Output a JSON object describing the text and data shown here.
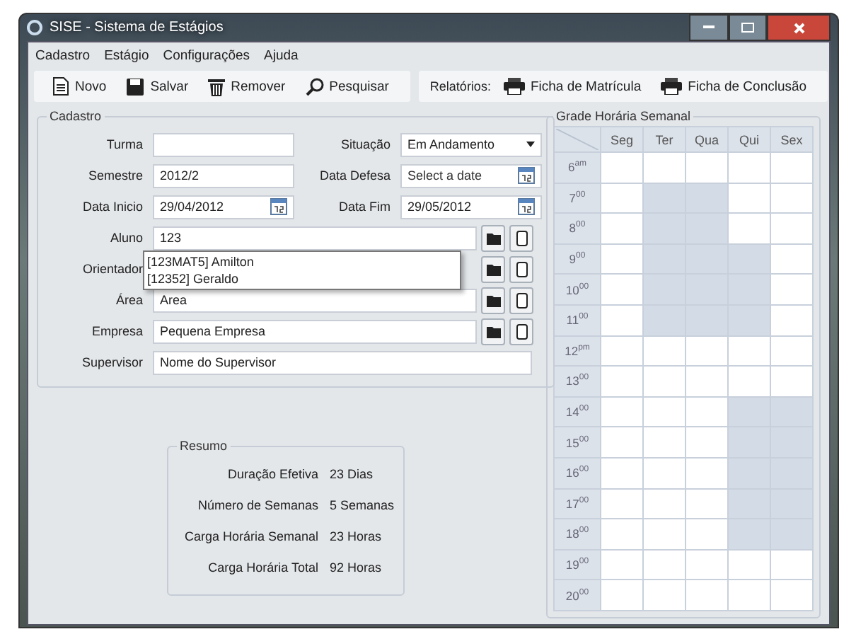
{
  "window": {
    "title": "SISE - Sistema de Estágios"
  },
  "menu": [
    "Cadastro",
    "Estágio",
    "Configurações",
    "Ajuda"
  ],
  "toolbar": [
    {
      "kind": "new",
      "label": "Novo"
    },
    {
      "kind": "save",
      "label": "Salvar"
    },
    {
      "kind": "delete",
      "label": "Remover"
    },
    {
      "kind": "search",
      "label": "Pesquisar"
    }
  ],
  "reports": {
    "label": "Relatórios:",
    "items": [
      "Ficha de Matrícula",
      "Ficha de Conclusão"
    ]
  },
  "cadastro": {
    "title": "Cadastro",
    "pairs": [
      {
        "left": {
          "label": "Turma",
          "kind": "text"
        },
        "right": {
          "label": "Situação",
          "kind": "select",
          "value": "Em Andamento"
        }
      },
      {
        "left": {
          "label": "Semestre",
          "kind": "text",
          "value": "2012/2"
        },
        "right": {
          "label": "Data Defesa",
          "kind": "date",
          "placeholder": "Select a date"
        }
      },
      {
        "left": {
          "label": "Data Inicio",
          "kind": "date",
          "value": "29/04/2012"
        },
        "right": {
          "label": "Data Fim",
          "kind": "date",
          "value": "29/05/2012"
        }
      }
    ],
    "lookups": [
      {
        "label": "Aluno",
        "value": "123",
        "buttons": true
      },
      {
        "label": "Orientador",
        "buttons": true
      },
      {
        "label": "Área",
        "value": "Area",
        "buttons": true
      },
      {
        "label": "Empresa",
        "value": "Pequena Empresa",
        "buttons": true
      },
      {
        "label": "Supervisor",
        "value": "Nome do Supervisor",
        "buttons": false
      }
    ],
    "suggestions": [
      "[123MAT5] Amilton",
      "[12352] Geraldo"
    ]
  },
  "resumo": {
    "title": "Resumo",
    "rows": [
      {
        "label": "Duração Efetiva",
        "value": "23 Dias"
      },
      {
        "label": "Número de Semanas",
        "value": "5 Semanas"
      },
      {
        "label": "Carga Horária Semanal",
        "value": "23 Horas"
      },
      {
        "label": "Carga Horária Total",
        "value": "92 Horas"
      }
    ]
  },
  "grade": {
    "title": "Grade Horária Semanal",
    "days": [
      "Seg",
      "Ter",
      "Qua",
      "Qui",
      "Sex"
    ],
    "rows": [
      {
        "hour": "6$^{am}$",
        "busy": [
          false,
          false,
          false,
          false,
          false
        ]
      },
      {
        "hour": "7$^{00}$",
        "busy": [
          false,
          true,
          true,
          false,
          false
        ]
      },
      {
        "hour": "8$^{00}$",
        "busy": [
          false,
          true,
          true,
          false,
          false
        ]
      },
      {
        "hour": "9$^{00}$",
        "busy": [
          false,
          true,
          true,
          true,
          false
        ]
      },
      {
        "hour": "10$^{00}$",
        "busy": [
          false,
          true,
          true,
          true,
          false
        ]
      },
      {
        "hour": "11$^{00}$",
        "busy": [
          false,
          true,
          true,
          true,
          false
        ]
      },
      {
        "hour": "12$^{pm}$",
        "busy": [
          false,
          false,
          false,
          false,
          false
        ]
      },
      {
        "hour": "13$^{00}$",
        "busy": [
          false,
          false,
          false,
          false,
          false
        ]
      },
      {
        "hour": "14$^{00}$",
        "busy": [
          false,
          false,
          false,
          true,
          true
        ]
      },
      {
        "hour": "15$^{00}$",
        "busy": [
          false,
          false,
          false,
          true,
          true
        ]
      },
      {
        "hour": "16$^{00}$",
        "busy": [
          false,
          false,
          false,
          true,
          true
        ]
      },
      {
        "hour": "17$^{00}$",
        "busy": [
          false,
          false,
          false,
          true,
          true
        ]
      },
      {
        "hour": "18$^{00}$",
        "busy": [
          false,
          false,
          false,
          true,
          true
        ]
      },
      {
        "hour": "19$^{00}$",
        "busy": [
          false,
          false,
          false,
          false,
          false
        ]
      },
      {
        "hour": "20$^{00}$",
        "busy": [
          false,
          false,
          false,
          false,
          false
        ]
      }
    ]
  }
}
